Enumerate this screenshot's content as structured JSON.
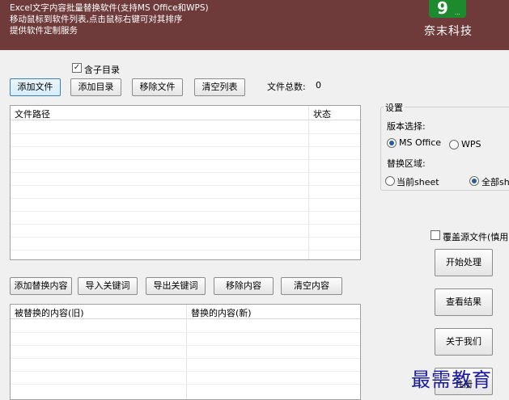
{
  "header": {
    "line1": "Excel文字内容批量替换软件(支持MS  Office和WPS)",
    "line2": "移动鼠标到软件列表,点击鼠标右键可对其排序",
    "line3": "提供软件定制服务",
    "logo_mark": "9",
    "logo_dots": "...",
    "brand": "奈末科技",
    "bg_color": "#6e3a3a"
  },
  "top": {
    "include_subdir_label": "含子目录",
    "include_subdir_checked": true,
    "add_file": "添加文件",
    "add_dir": "添加目录",
    "remove_file": "移除文件",
    "clear_list": "清空列表",
    "file_count_label": "文件总数:",
    "file_count_value": "0"
  },
  "file_table": {
    "col_path": "文件路径",
    "col_status": "状态"
  },
  "settings": {
    "title": "设置",
    "version_label": "版本选择:",
    "ms_office": "MS Office",
    "wps": "WPS",
    "selected_version": "MS Office",
    "area_label": "替换区域:",
    "current_sheet": "当前sheet",
    "all_sheets": "全部she",
    "selected_area": "全部sheet"
  },
  "options": {
    "overwrite_label": "覆盖源文件(慎用)",
    "overwrite_checked": false
  },
  "actions": {
    "start": "开始处理",
    "view_result": "查看结果",
    "about": "关于我们",
    "register": "注册"
  },
  "replace_toolbar": {
    "add_content": "添加替换内容",
    "import_keywords": "导入关键词",
    "export_keywords": "导出关键词",
    "remove_content": "移除内容",
    "clear_content": "清空内容"
  },
  "replace_table": {
    "col_old": "被替换的内容(旧)",
    "col_new": "替换的内容(新)"
  },
  "watermark": "最需教育"
}
